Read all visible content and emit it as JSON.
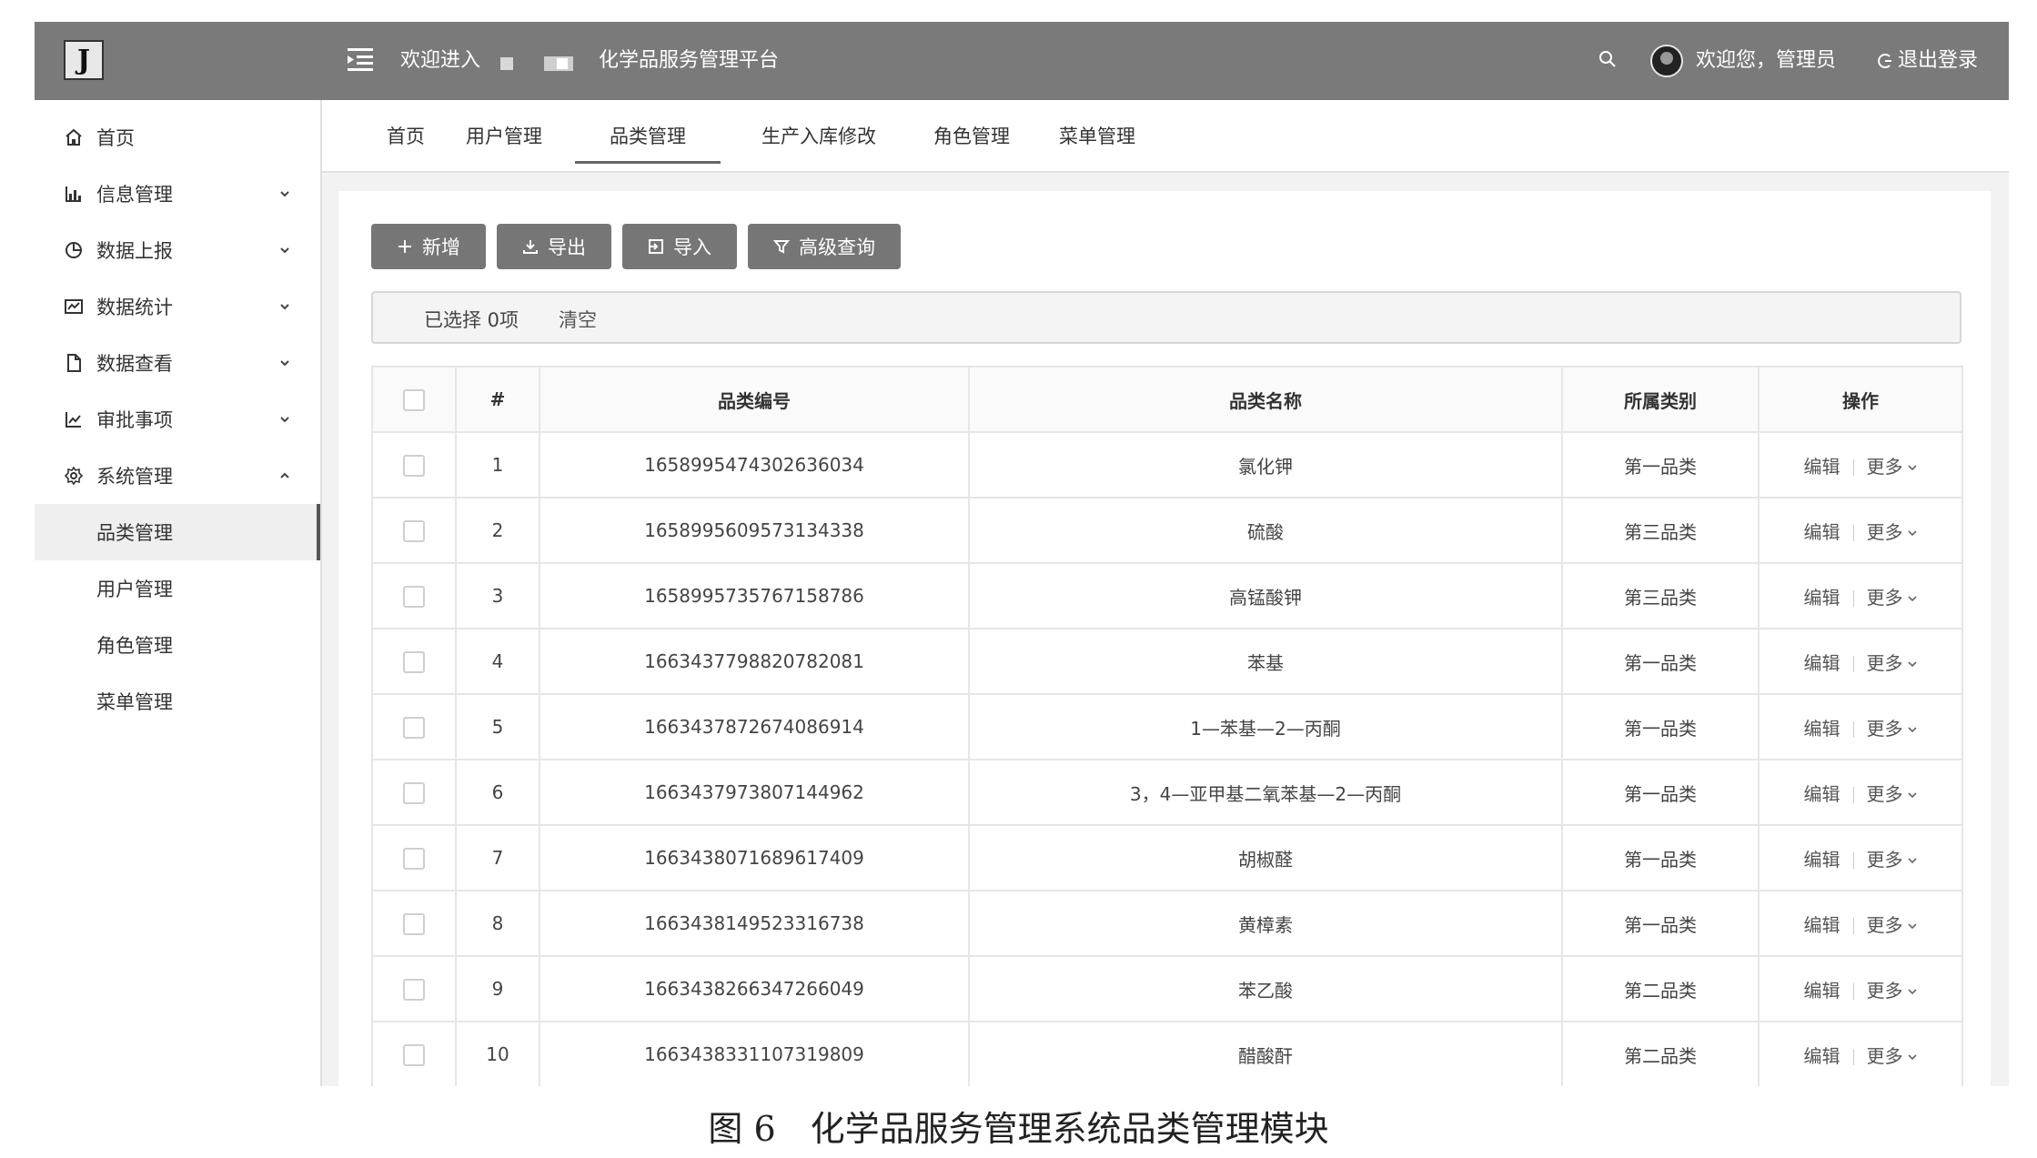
{
  "header": {
    "logo_letter": "J",
    "title_prefix": "欢迎进入",
    "title_suffix": "化学品服务管理平台",
    "welcome_user": "欢迎您，管理员",
    "logout": "退出登录"
  },
  "sidebar": {
    "items": [
      {
        "label": "首页",
        "icon": "home-icon",
        "expandable": false
      },
      {
        "label": "信息管理",
        "icon": "bar-chart-icon",
        "expandable": true
      },
      {
        "label": "数据上报",
        "icon": "pie-chart-icon",
        "expandable": true
      },
      {
        "label": "数据统计",
        "icon": "line-chart-box-icon",
        "expandable": true
      },
      {
        "label": "数据查看",
        "icon": "document-icon",
        "expandable": true
      },
      {
        "label": "审批事项",
        "icon": "trend-icon",
        "expandable": true
      },
      {
        "label": "系统管理",
        "icon": "gear-icon",
        "expandable": true,
        "expanded": true
      }
    ],
    "sub_items": [
      {
        "label": "品类管理",
        "active": true
      },
      {
        "label": "用户管理",
        "active": false
      },
      {
        "label": "角色管理",
        "active": false
      },
      {
        "label": "菜单管理",
        "active": false
      }
    ]
  },
  "tabs": [
    {
      "label": "首页",
      "active": false
    },
    {
      "label": "用户管理",
      "active": false
    },
    {
      "label": "品类管理",
      "active": true
    },
    {
      "label": "生产入库修改",
      "active": false
    },
    {
      "label": "角色管理",
      "active": false
    },
    {
      "label": "菜单管理",
      "active": false
    }
  ],
  "toolbar": {
    "add": "新增",
    "export": "导出",
    "import": "导入",
    "advanced_search": "高级查询"
  },
  "selection": {
    "text": "已选择 0项",
    "clear": "清空"
  },
  "table": {
    "columns": [
      "#",
      "品类编号",
      "品类名称",
      "所属类别",
      "操作"
    ],
    "edit_label": "编辑",
    "more_label": "更多",
    "rows": [
      {
        "idx": "1",
        "code": "1658995474302636034",
        "name": "氯化钾",
        "category": "第一品类"
      },
      {
        "idx": "2",
        "code": "1658995609573134338",
        "name": "硫酸",
        "category": "第三品类"
      },
      {
        "idx": "3",
        "code": "1658995735767158786",
        "name": "高锰酸钾",
        "category": "第三品类"
      },
      {
        "idx": "4",
        "code": "1663437798820782081",
        "name": "苯基",
        "category": "第一品类"
      },
      {
        "idx": "5",
        "code": "1663437872674086914",
        "name": "1—苯基—2—丙酮",
        "category": "第一品类"
      },
      {
        "idx": "6",
        "code": "1663437973807144962",
        "name": "3，4—亚甲基二氧苯基—2—丙酮",
        "category": "第一品类"
      },
      {
        "idx": "7",
        "code": "1663438071689617409",
        "name": "胡椒醛",
        "category": "第一品类"
      },
      {
        "idx": "8",
        "code": "1663438149523316738",
        "name": "黄樟素",
        "category": "第一品类"
      },
      {
        "idx": "9",
        "code": "1663438266347266049",
        "name": "苯乙酸",
        "category": "第二品类"
      },
      {
        "idx": "10",
        "code": "1663438331107319809",
        "name": "醋酸酐",
        "category": "第二品类"
      }
    ]
  },
  "caption": "图 6　化学品服务管理系统品类管理模块"
}
